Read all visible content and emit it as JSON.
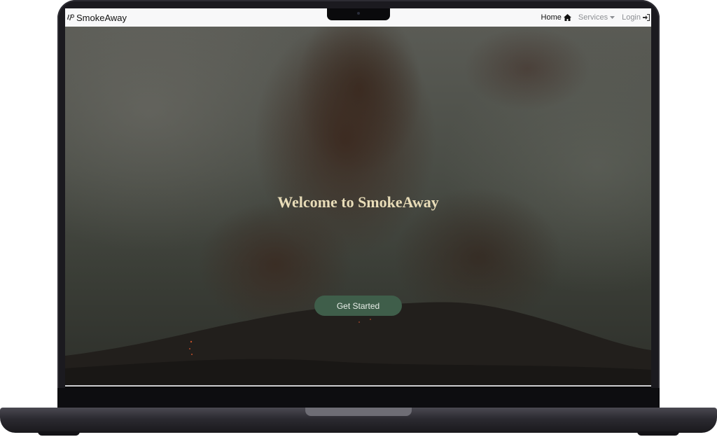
{
  "navbar": {
    "brand_name": "SmokeAway",
    "links": [
      {
        "label": "Home",
        "icon": "home-icon"
      },
      {
        "label": "Services",
        "icon": "caret-down-icon"
      },
      {
        "label": "Login",
        "icon": "login-icon"
      }
    ]
  },
  "hero": {
    "title": "Welcome to SmokeAway",
    "cta_label": "Get Started"
  },
  "colors": {
    "accent_button": "#3f5e4a",
    "title_text": "#e8dcb8",
    "navbar_bg": "#f8f8f9"
  }
}
